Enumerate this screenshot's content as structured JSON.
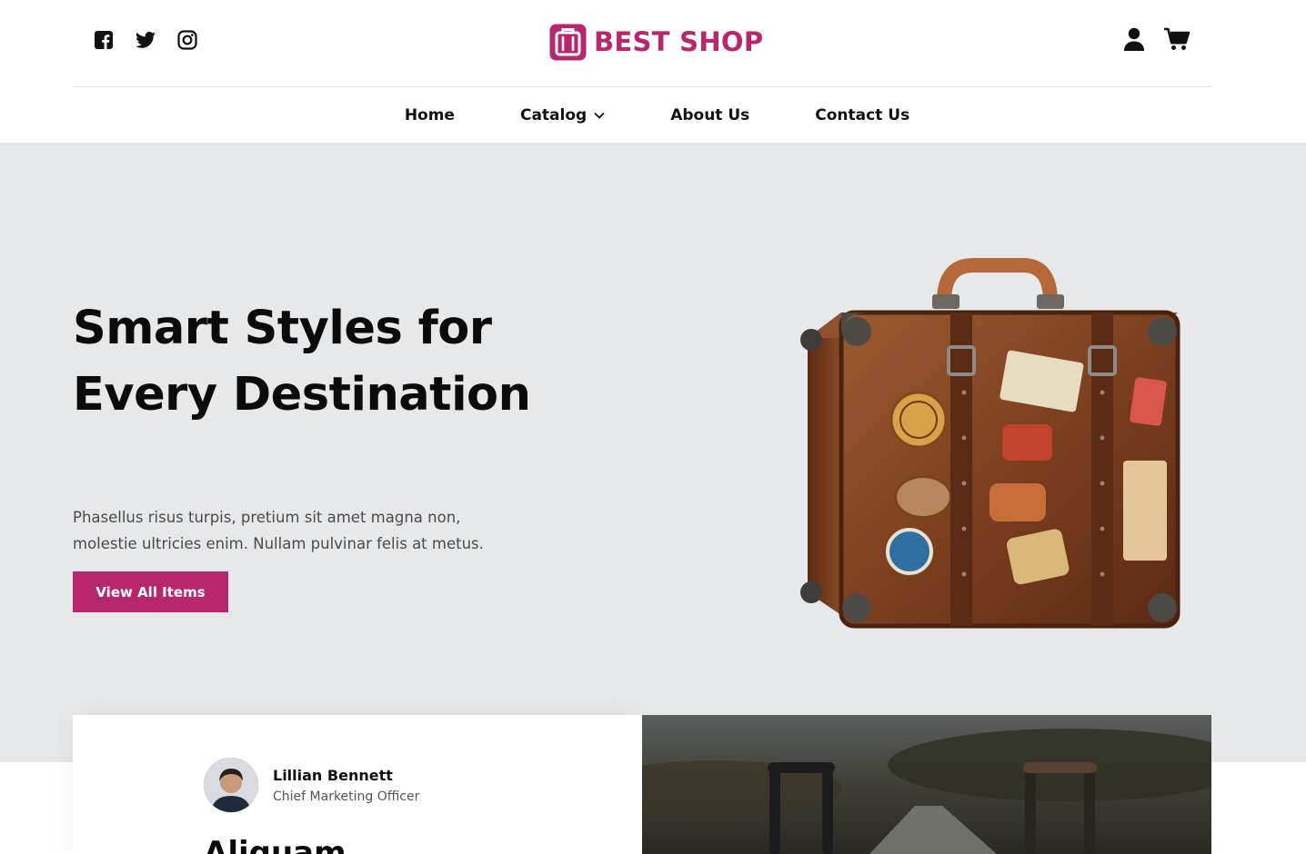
{
  "header": {
    "socials": [
      {
        "icon": "facebook-icon"
      },
      {
        "icon": "twitter-icon"
      },
      {
        "icon": "instagram-icon"
      }
    ],
    "logo_text": "BEST SHOP",
    "brand_color": "#b8276e",
    "actions": [
      {
        "icon": "user-icon"
      },
      {
        "icon": "cart-icon"
      }
    ]
  },
  "nav": {
    "items": [
      {
        "label": "Home"
      },
      {
        "label": "Catalog",
        "has_dropdown": true
      },
      {
        "label": "About Us"
      },
      {
        "label": "Contact Us"
      }
    ]
  },
  "hero": {
    "title": "Smart Styles for Every Destination",
    "text": "Phasellus risus turpis, pretium sit amet magna non, molestie ultricies enim. Nullam pulvinar felis at metus.",
    "cta_label": "View All Items",
    "background": "#e7e8ea",
    "image": "vintage-suitcase-with-travel-stickers"
  },
  "testimonial": {
    "name": "Lillian Bennett",
    "role": "Chief Marketing Officer",
    "heading": "Aliquam"
  },
  "photo": {
    "image": "suitcases-on-road-photo"
  }
}
